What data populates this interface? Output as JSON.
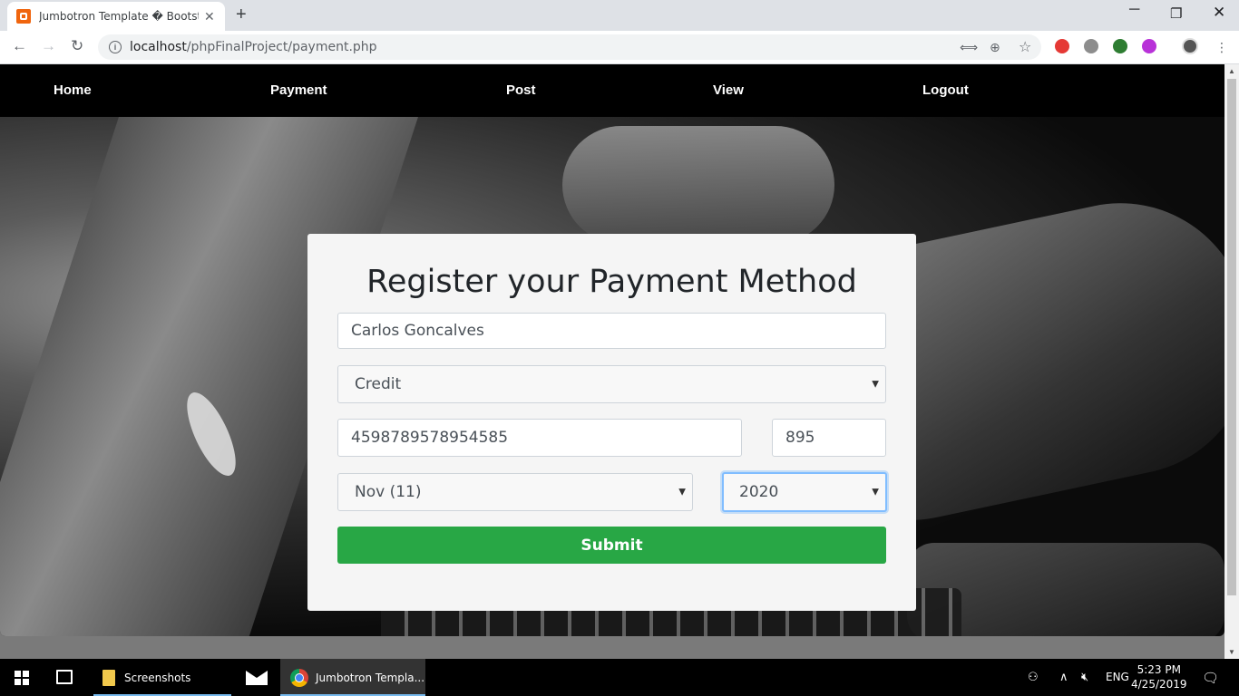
{
  "browser": {
    "tab_title": "Jumbotron Template � Bootstra",
    "url_host": "localhost",
    "url_path": "/phpFinalProject/payment.php",
    "accent": "#dee1e6"
  },
  "navbar": {
    "items": [
      {
        "label": "Home"
      },
      {
        "label": "Payment"
      },
      {
        "label": "Post"
      },
      {
        "label": "View"
      },
      {
        "label": "Logout"
      }
    ]
  },
  "form": {
    "title": "Register your Payment Method",
    "name_value": "Carlos Goncalves",
    "card_type_selected": "Credit",
    "card_number_value": "4598789578954585",
    "cvv_value": "895",
    "month_selected": "Nov (11)",
    "year_selected": "2020",
    "submit_label": "Submit",
    "submit_color": "#28a745"
  },
  "taskbar": {
    "apps": [
      {
        "label": "Screenshots",
        "icon": "folder-icon"
      },
      {
        "label": "",
        "icon": "mail-icon"
      },
      {
        "label": "Jumbotron Templa...",
        "icon": "chrome-icon"
      }
    ],
    "language": "ENG",
    "time": "5:23 PM",
    "date": "4/25/2019"
  }
}
